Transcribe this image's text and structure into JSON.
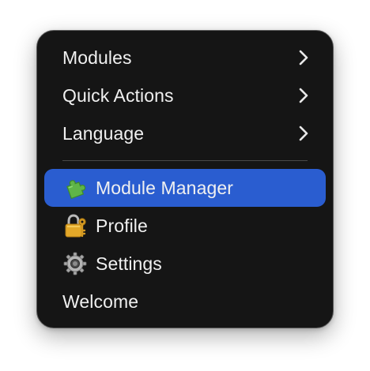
{
  "menu": {
    "items": [
      {
        "label": "Modules",
        "submenu": true,
        "icon": null
      },
      {
        "label": "Quick Actions",
        "submenu": true,
        "icon": null
      },
      {
        "label": "Language",
        "submenu": true,
        "icon": null
      },
      {
        "label": "Module Manager",
        "submenu": false,
        "icon": "puzzle-piece-icon",
        "selected": true
      },
      {
        "label": "Profile",
        "submenu": false,
        "icon": "padlock-key-icon"
      },
      {
        "label": "Settings",
        "submenu": false,
        "icon": "gear-icon"
      },
      {
        "label": "Welcome",
        "submenu": false,
        "icon": null
      }
    ]
  },
  "colors": {
    "menu_background": "#151515",
    "selection": "#2a5dd0",
    "text": "#f0f0f0",
    "separator": "#4a4a4a"
  }
}
